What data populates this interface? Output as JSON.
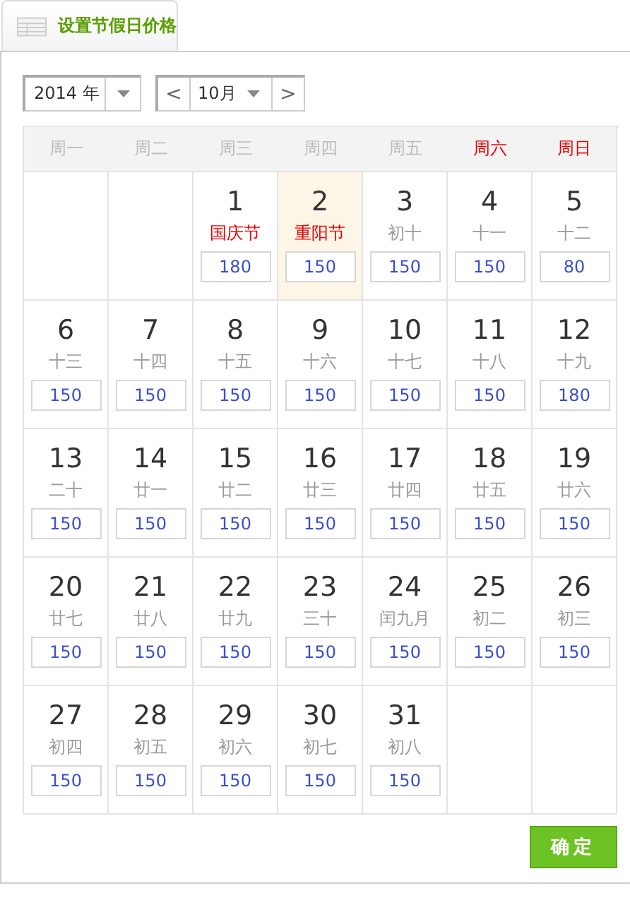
{
  "tab": {
    "title": "设置节假日价格"
  },
  "controls": {
    "year": "2014 年",
    "month": "10月",
    "prev": "<",
    "next": ">"
  },
  "weekdays": [
    {
      "label": "周一",
      "weekend": false
    },
    {
      "label": "周二",
      "weekend": false
    },
    {
      "label": "周三",
      "weekend": false
    },
    {
      "label": "周四",
      "weekend": false
    },
    {
      "label": "周五",
      "weekend": false
    },
    {
      "label": "周六",
      "weekend": true
    },
    {
      "label": "周日",
      "weekend": true
    }
  ],
  "days": [
    {
      "kind": "empty"
    },
    {
      "kind": "empty"
    },
    {
      "kind": "day",
      "day": "1",
      "lunar": "国庆节",
      "holiday": true,
      "selected": false,
      "price": "180"
    },
    {
      "kind": "day",
      "day": "2",
      "lunar": "重阳节",
      "holiday": true,
      "selected": true,
      "price": "150"
    },
    {
      "kind": "day",
      "day": "3",
      "lunar": "初十",
      "holiday": false,
      "selected": false,
      "price": "150"
    },
    {
      "kind": "day",
      "day": "4",
      "lunar": "十一",
      "holiday": false,
      "selected": false,
      "price": "150"
    },
    {
      "kind": "day",
      "day": "5",
      "lunar": "十二",
      "holiday": false,
      "selected": false,
      "price": "80"
    },
    {
      "kind": "day",
      "day": "6",
      "lunar": "十三",
      "holiday": false,
      "selected": false,
      "price": "150"
    },
    {
      "kind": "day",
      "day": "7",
      "lunar": "十四",
      "holiday": false,
      "selected": false,
      "price": "150"
    },
    {
      "kind": "day",
      "day": "8",
      "lunar": "十五",
      "holiday": false,
      "selected": false,
      "price": "150"
    },
    {
      "kind": "day",
      "day": "9",
      "lunar": "十六",
      "holiday": false,
      "selected": false,
      "price": "150"
    },
    {
      "kind": "day",
      "day": "10",
      "lunar": "十七",
      "holiday": false,
      "selected": false,
      "price": "150"
    },
    {
      "kind": "day",
      "day": "11",
      "lunar": "十八",
      "holiday": false,
      "selected": false,
      "price": "150"
    },
    {
      "kind": "day",
      "day": "12",
      "lunar": "十九",
      "holiday": false,
      "selected": false,
      "price": "180"
    },
    {
      "kind": "day",
      "day": "13",
      "lunar": "二十",
      "holiday": false,
      "selected": false,
      "price": "150"
    },
    {
      "kind": "day",
      "day": "14",
      "lunar": "廿一",
      "holiday": false,
      "selected": false,
      "price": "150"
    },
    {
      "kind": "day",
      "day": "15",
      "lunar": "廿二",
      "holiday": false,
      "selected": false,
      "price": "150"
    },
    {
      "kind": "day",
      "day": "16",
      "lunar": "廿三",
      "holiday": false,
      "selected": false,
      "price": "150"
    },
    {
      "kind": "day",
      "day": "17",
      "lunar": "廿四",
      "holiday": false,
      "selected": false,
      "price": "150"
    },
    {
      "kind": "day",
      "day": "18",
      "lunar": "廿五",
      "holiday": false,
      "selected": false,
      "price": "150"
    },
    {
      "kind": "day",
      "day": "19",
      "lunar": "廿六",
      "holiday": false,
      "selected": false,
      "price": "150"
    },
    {
      "kind": "day",
      "day": "20",
      "lunar": "廿七",
      "holiday": false,
      "selected": false,
      "price": "150"
    },
    {
      "kind": "day",
      "day": "21",
      "lunar": "廿八",
      "holiday": false,
      "selected": false,
      "price": "150"
    },
    {
      "kind": "day",
      "day": "22",
      "lunar": "廿九",
      "holiday": false,
      "selected": false,
      "price": "150"
    },
    {
      "kind": "day",
      "day": "23",
      "lunar": "三十",
      "holiday": false,
      "selected": false,
      "price": "150"
    },
    {
      "kind": "day",
      "day": "24",
      "lunar": "闰九月",
      "holiday": false,
      "selected": false,
      "price": "150"
    },
    {
      "kind": "day",
      "day": "25",
      "lunar": "初二",
      "holiday": false,
      "selected": false,
      "price": "150"
    },
    {
      "kind": "day",
      "day": "26",
      "lunar": "初三",
      "holiday": false,
      "selected": false,
      "price": "150"
    },
    {
      "kind": "day",
      "day": "27",
      "lunar": "初四",
      "holiday": false,
      "selected": false,
      "price": "150"
    },
    {
      "kind": "day",
      "day": "28",
      "lunar": "初五",
      "holiday": false,
      "selected": false,
      "price": "150"
    },
    {
      "kind": "day",
      "day": "29",
      "lunar": "初六",
      "holiday": false,
      "selected": false,
      "price": "150"
    },
    {
      "kind": "day",
      "day": "30",
      "lunar": "初七",
      "holiday": false,
      "selected": false,
      "price": "150"
    },
    {
      "kind": "day",
      "day": "31",
      "lunar": "初八",
      "holiday": false,
      "selected": false,
      "price": "150"
    },
    {
      "kind": "empty"
    },
    {
      "kind": "empty"
    }
  ],
  "confirm_button": "确定"
}
